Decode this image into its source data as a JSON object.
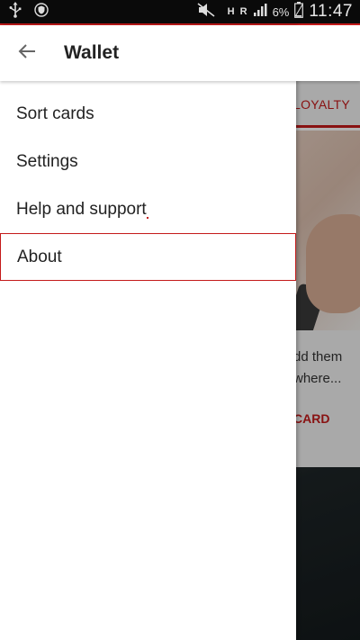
{
  "status_bar": {
    "network_h": "H",
    "network_r": "R",
    "battery_percent": "6%",
    "time": "11:47"
  },
  "header": {
    "title": "Wallet"
  },
  "drawer": {
    "items": [
      {
        "label": "Sort cards"
      },
      {
        "label": "Settings"
      },
      {
        "label": "Help and support"
      },
      {
        "label": "About"
      }
    ]
  },
  "background": {
    "tab_label": "LOYALTY",
    "desc_line1": "dd them",
    "desc_line2": "where...",
    "action_label": "CARD"
  },
  "colors": {
    "accent": "#c41a1a",
    "status_bar_bg": "#0a0a0a"
  },
  "icons": [
    "usb-icon",
    "shield-icon",
    "mute-icon",
    "signal-icon",
    "battery-icon",
    "back-arrow-icon"
  ]
}
